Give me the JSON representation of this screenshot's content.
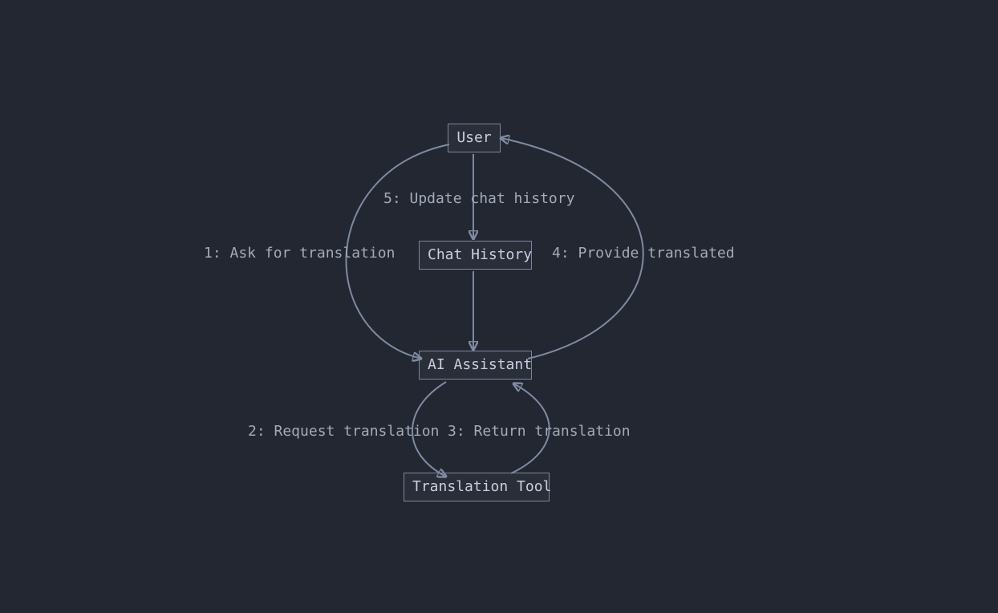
{
  "diagram": {
    "nodes": {
      "user": "User",
      "chat_history": "Chat History",
      "ai_assistant": "AI Assistant",
      "translation_tool": "Translation Tool"
    },
    "edges": {
      "e1": "1: Ask for translation",
      "e2": "2: Request translation",
      "e3": "3: Return translation",
      "e4": "4: Provide translated",
      "e5": "5: Update chat history"
    }
  }
}
